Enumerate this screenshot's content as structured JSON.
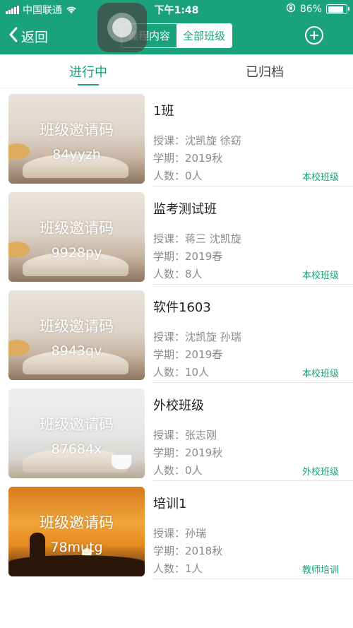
{
  "status_bar": {
    "carrier": "中国联通",
    "time": "下午1:48",
    "battery": "86%",
    "battery_level": 0.86,
    "icons": [
      "signal-icon",
      "wifi-icon",
      "rotation-lock-icon",
      "battery-icon"
    ]
  },
  "nav": {
    "back_label": "返回",
    "segments": [
      "课程内容",
      "全部班级"
    ],
    "active_segment": "全部班级",
    "add_icon": "plus-circle-icon"
  },
  "subtabs": {
    "active": "进行中",
    "archived": "已归档"
  },
  "colors": {
    "accent": "#1aa37a",
    "meta_text": "#8a8a8a"
  },
  "labels": {
    "cover_title": "班级邀请码",
    "teacher_prefix": "授课：",
    "term_prefix": "学期：",
    "count_prefix": "人数："
  },
  "classes": [
    {
      "name": "1班",
      "code": "84yyzh",
      "teachers": "沈凯旋 徐窈",
      "term": "2019秋",
      "count": "0人",
      "tag": "本校班级"
    },
    {
      "name": "监考测试班",
      "code": "9928py",
      "teachers": "蒋三 沈凯旋",
      "term": "2019春",
      "count": "8人",
      "tag": "本校班级"
    },
    {
      "name": "软件1603",
      "code": "8943qv",
      "teachers": "沈凯旋 孙瑞",
      "term": "2019春",
      "count": "10人",
      "tag": "本校班级"
    },
    {
      "name": "外校班级",
      "code": "87684x",
      "teachers": "张志刚",
      "term": "2019秋",
      "count": "0人",
      "tag": "外校班级"
    },
    {
      "name": "培训1",
      "code": "78mutg",
      "teachers": "孙瑞",
      "term": "2018秋",
      "count": "1人",
      "tag": "教师培训"
    }
  ]
}
